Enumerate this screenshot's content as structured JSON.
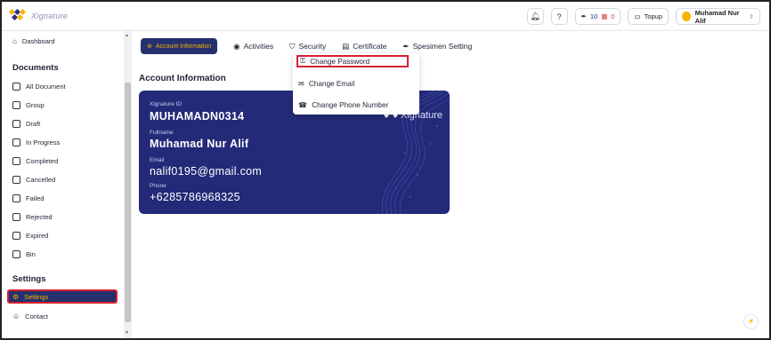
{
  "app": {
    "logo_text": "Xignature"
  },
  "topbar": {
    "notification_icon": "bell-icon",
    "help_icon": "help-icon",
    "signature_quota": "10",
    "qr_quota": "0",
    "topup_label": "Topup",
    "user_name": "Muhamad Nur Alif"
  },
  "sidebar": {
    "dashboard": "Dashboard",
    "documents_title": "Documents",
    "documents": [
      "All Document",
      "Group",
      "Draft",
      "In Progress",
      "Completed",
      "Cancelled",
      "Failed",
      "Rejected",
      "Expired",
      "Bin"
    ],
    "settings_title": "Settings",
    "settings": "Settings",
    "contact": "Contact"
  },
  "tabs": {
    "account_information": "Account Information",
    "activities": "Activities",
    "security": "Security",
    "certificate": "Certificate",
    "specimen_setting": "Spesimen Setting"
  },
  "security_menu": {
    "change_password": "Change Password",
    "change_email": "Change Email",
    "change_phone": "Change Phone Number"
  },
  "account": {
    "section_title": "Account Information",
    "card_brand": "Xignature",
    "id_label": "Xignature ID",
    "id_value": "MUHAMADN0314",
    "fullname_label": "Fullname",
    "fullname_value": "Muhamad Nur Alif",
    "email_label": "Email",
    "email_value": "nalif0195@gmail.com",
    "phone_label": "Phone",
    "phone_value": "+6285786968325"
  },
  "colors": {
    "primary": "#25306e",
    "accent": "#f5b400",
    "highlight": "#d6202f"
  }
}
